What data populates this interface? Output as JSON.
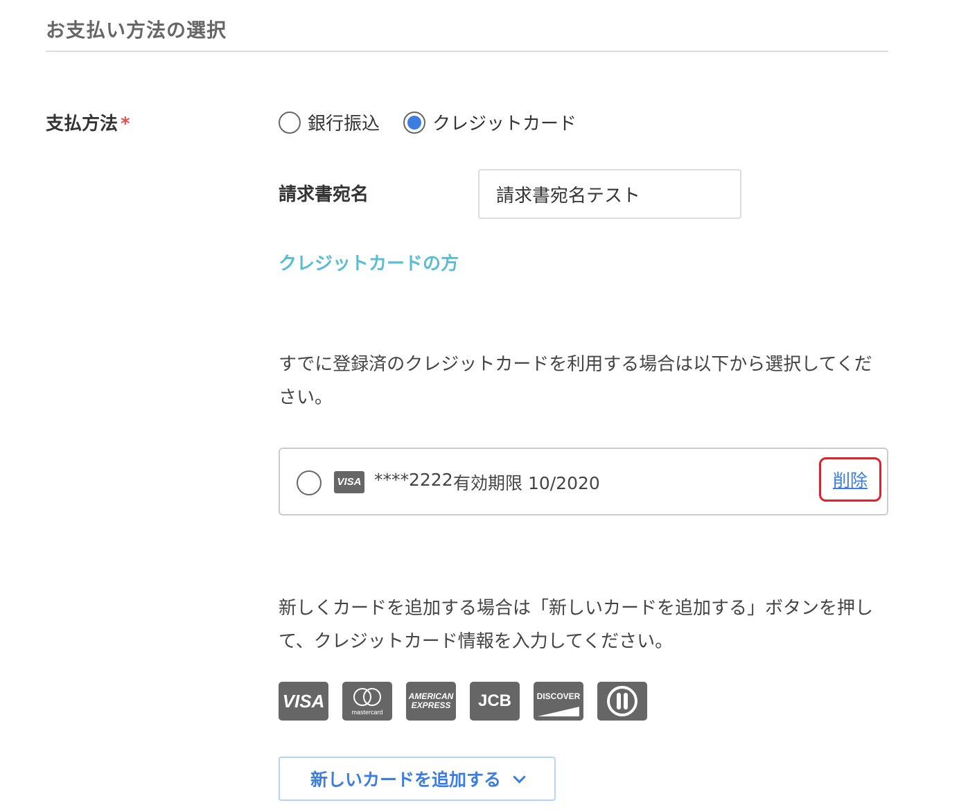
{
  "section": {
    "title": "お支払い方法の選択"
  },
  "payment": {
    "label": "支払方法",
    "required_mark": "*",
    "options": [
      {
        "label": "銀行振込",
        "checked": false
      },
      {
        "label": "クレジットカード",
        "checked": true
      }
    ]
  },
  "invoice": {
    "label": "請求書宛名",
    "value": "請求書宛名テスト"
  },
  "credit_card": {
    "heading": "クレジットカードの方",
    "saved_instructions": "すでに登録済のクレジットカードを利用する場合は以下から選択してください。",
    "saved_cards": [
      {
        "brand": "VISA",
        "number": "****2222",
        "expiry": "有効期限 10/2020",
        "delete_label": "削除",
        "selected": false
      }
    ],
    "new_instructions": "新しくカードを追加する場合は「新しいカードを追加する」ボタンを押して、クレジットカード情報を入力してください。",
    "accepted_brands": [
      {
        "name": "VISA",
        "icon": "visa-icon"
      },
      {
        "name": "mastercard",
        "icon": "mastercard-icon"
      },
      {
        "name": "AMERICAN EXPRESS",
        "icon": "amex-icon"
      },
      {
        "name": "JCB",
        "icon": "jcb-icon"
      },
      {
        "name": "DISCOVER",
        "icon": "discover-icon"
      },
      {
        "name": "Diners Club",
        "icon": "diners-icon"
      }
    ],
    "add_button_label": "新しいカードを追加する"
  },
  "colors": {
    "accent_blue": "#3b7de0",
    "heading_cyan": "#5bbdd4",
    "required_red": "#e94e4e",
    "highlight_red": "#e0202c"
  }
}
